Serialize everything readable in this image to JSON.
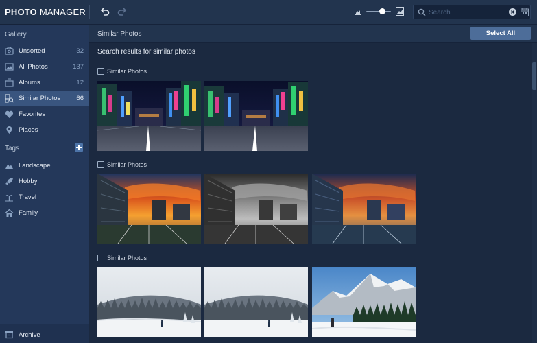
{
  "app": {
    "logo_bold": "PHOTO",
    "logo_rest": "MANAGER"
  },
  "toolbar": {
    "undo_icon": "undo-icon",
    "redo_icon": "redo-icon",
    "zoom_level": 0.55
  },
  "search": {
    "placeholder": "Search",
    "value": ""
  },
  "sidebar": {
    "gallery_heading": "Gallery",
    "items": [
      {
        "label": "Unsorted",
        "count": "32",
        "icon": "unsorted-icon"
      },
      {
        "label": "All Photos",
        "count": "137",
        "icon": "photo-icon"
      },
      {
        "label": "Albums",
        "count": "12",
        "icon": "albums-icon"
      },
      {
        "label": "Similar Photos",
        "count": "66",
        "icon": "similar-photos-icon",
        "active": true
      },
      {
        "label": "Favorites",
        "count": "",
        "icon": "heart-icon"
      },
      {
        "label": "Places",
        "count": "",
        "icon": "map-pin-icon"
      }
    ],
    "tags_heading": "Tags",
    "tags": [
      {
        "label": "Landscape",
        "icon": "landscape-icon"
      },
      {
        "label": "Hobby",
        "icon": "rocket-icon"
      },
      {
        "label": "Travel",
        "icon": "palm-tree-icon"
      },
      {
        "label": "Family",
        "icon": "house-icon"
      }
    ],
    "archive_label": "Archive"
  },
  "main": {
    "title": "Similar Photos",
    "select_all_label": "Select All",
    "results_text": "Search results for similar photos",
    "groups": [
      {
        "label": "Similar Photos",
        "photos": [
          "city-night-street-1",
          "city-night-street-2"
        ]
      },
      {
        "label": "Similar Photos",
        "photos": [
          "sunset-building-color",
          "sunset-building-bw",
          "sunset-building-blue"
        ]
      },
      {
        "label": "Similar Photos",
        "photos": [
          "snow-forest-hiker-1",
          "snow-forest-hiker-2",
          "snow-mountain-walker"
        ]
      }
    ]
  },
  "colors": {
    "accent": "#4d6d99",
    "active_item": "#39557f",
    "sidebar": "#24385a",
    "background": "#1b2940"
  }
}
